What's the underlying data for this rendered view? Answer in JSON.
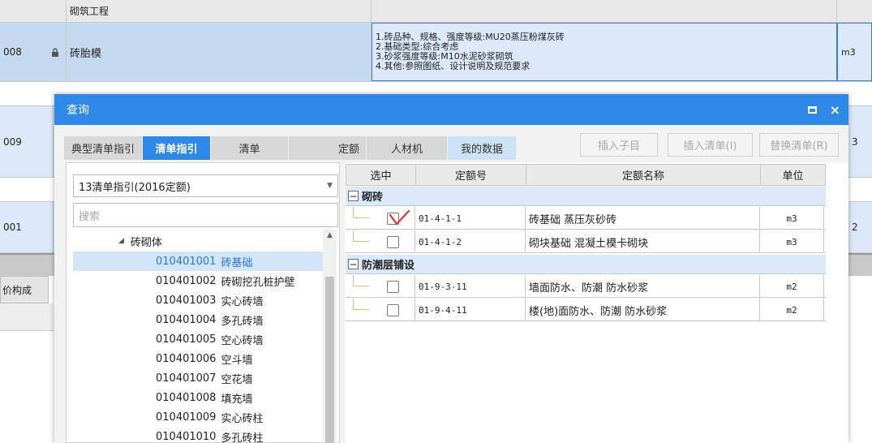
{
  "background": {
    "header_title": "砌筑工程",
    "row_008": {
      "code": "008",
      "name": "砖胎模",
      "unit": "m3",
      "desc": [
        "1.砖品种、规格、强度等级:MU20蒸压粉煤灰砖",
        "2.基础类型:综合考虑",
        "3.砂浆强度等级:M10水泥砂浆砌筑",
        "4.其他:参照图纸、设计说明及规范要求"
      ]
    },
    "row_009": {
      "code": "009",
      "tail": "3"
    },
    "row_001": {
      "code": "001",
      "tail": "2"
    },
    "bottom_tab": "价构成"
  },
  "dialog": {
    "title": "查询",
    "max_glyph": "□",
    "close_glyph": "×",
    "tabs": [
      "典型清单指引",
      "清单指引",
      "清单",
      "定额",
      "人材机",
      "我的数据"
    ],
    "active_tab": "清单指引",
    "actions": {
      "insert_child": "插入子目",
      "insert_list": "插入清单(I)",
      "replace_list": "替换清单(R)"
    },
    "combo_value": "13清单指引(2016定额)",
    "search_placeholder": "搜索",
    "tree": {
      "group": "砖砌体",
      "items": [
        {
          "code": "010401001",
          "name": "砖基础",
          "selected": true
        },
        {
          "code": "010401002",
          "name": "砖砌挖孔桩护壁"
        },
        {
          "code": "010401003",
          "name": "实心砖墙"
        },
        {
          "code": "010401004",
          "name": "多孔砖墙"
        },
        {
          "code": "010401005",
          "name": "空心砖墙"
        },
        {
          "code": "010401006",
          "name": "空斗墙"
        },
        {
          "code": "010401007",
          "name": "空花墙"
        },
        {
          "code": "010401008",
          "name": "填充墙"
        },
        {
          "code": "010401009",
          "name": "实心砖柱"
        },
        {
          "code": "010401010",
          "name": "多孔砖柱"
        }
      ]
    },
    "table": {
      "headers": [
        "选中",
        "定额号",
        "定额名称",
        "单位"
      ],
      "groups": [
        {
          "name": "砌砖",
          "rows": [
            {
              "code": "01-4-1-1",
              "name": "砖基础 蒸压灰砂砖",
              "unit": "m3",
              "checked": true
            },
            {
              "code": "01-4-1-2",
              "name": "砌块基础 混凝土模卡砌块",
              "unit": "m3",
              "checked": false
            }
          ]
        },
        {
          "name": "防潮层铺设",
          "rows": [
            {
              "code": "01-9-3-11",
              "name": "墙面防水、防潮 防水砂浆",
              "unit": "m2",
              "checked": false
            },
            {
              "code": "01-9-4-11",
              "name": "楼(地)面防水、防潮 防水砂浆",
              "unit": "m2",
              "checked": false
            }
          ]
        }
      ]
    }
  },
  "colors": {
    "accent": "#2e89e6",
    "selection": "#d2e5f8",
    "row_highlight": "#dbe9fa",
    "check": "#e0323a"
  }
}
